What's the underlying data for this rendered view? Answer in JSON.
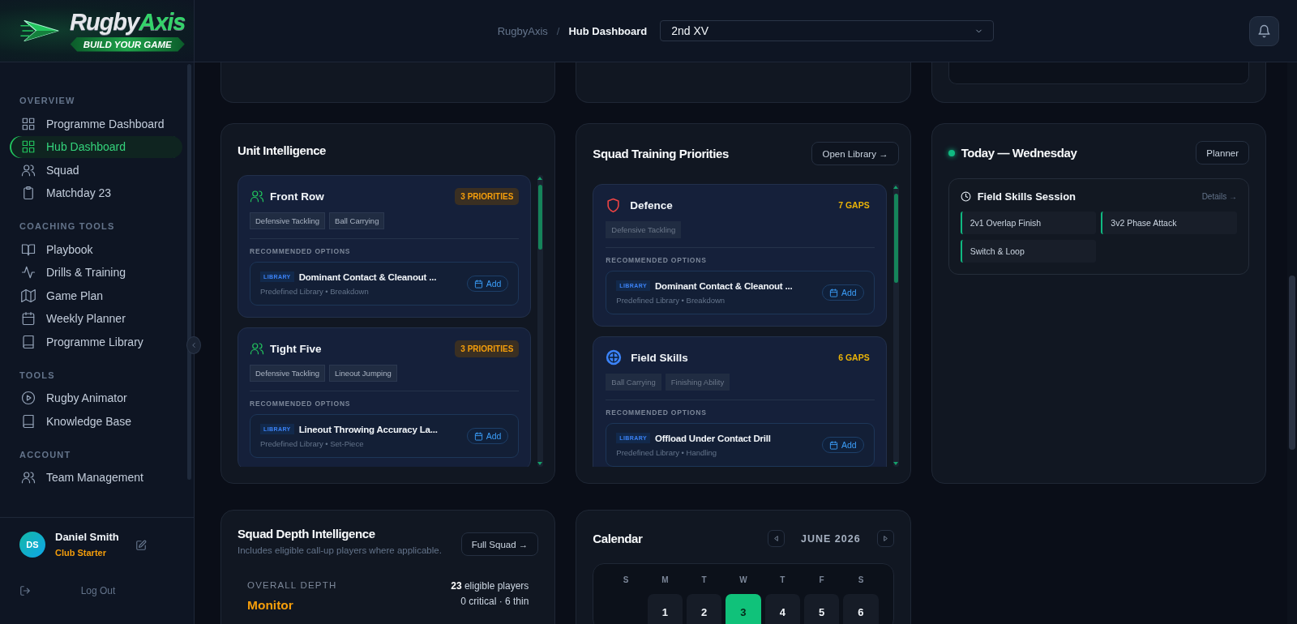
{
  "logo": {
    "name_a": "Rugby",
    "name_b": "Axis",
    "tagline": "BUILD YOUR GAME"
  },
  "header": {
    "breadcrumb": [
      "RugbyAxis",
      "Hub Dashboard"
    ],
    "breadcrumb_separator": "/",
    "team_select": {
      "value": "2nd XV"
    }
  },
  "sidebar": {
    "sections": [
      {
        "title": "OVERVIEW",
        "items": [
          {
            "label": "Programme Dashboard",
            "selected": false
          },
          {
            "label": "Hub Dashboard",
            "selected": true
          },
          {
            "label": "Squad",
            "selected": false
          },
          {
            "label": "Matchday 23",
            "selected": false
          }
        ]
      },
      {
        "title": "COACHING TOOLS",
        "items": [
          {
            "label": "Playbook",
            "selected": false
          },
          {
            "label": "Drills & Training",
            "selected": false
          },
          {
            "label": "Game Plan",
            "selected": false
          },
          {
            "label": "Weekly Planner",
            "selected": false
          },
          {
            "label": "Programme Library",
            "selected": false
          }
        ]
      },
      {
        "title": "TOOLS",
        "items": [
          {
            "label": "Rugby Animator",
            "selected": false
          },
          {
            "label": "Knowledge Base",
            "selected": false
          }
        ]
      },
      {
        "title": "ACCOUNT",
        "items": [
          {
            "label": "Team Management",
            "selected": false
          }
        ]
      }
    ],
    "user": {
      "initials": "DS",
      "name": "Daniel Smith",
      "plan": "Club Starter"
    },
    "logout": "Log Out"
  },
  "unit_intelligence": {
    "title": "Unit Intelligence",
    "units": [
      {
        "name": "Front Row",
        "badge": "3 PRIORITIES",
        "tags": [
          "Defensive Tackling",
          "Ball Carrying"
        ],
        "options_label": "RECOMMENDED OPTIONS",
        "options": [
          {
            "tag": "LIBRARY",
            "title": "Dominant Contact & Cleanout ...",
            "meta": "Predefined Library • Breakdown",
            "action": "Add"
          }
        ]
      },
      {
        "name": "Tight Five",
        "badge": "3 PRIORITIES",
        "tags": [
          "Defensive Tackling",
          "Lineout Jumping"
        ],
        "options_label": "RECOMMENDED OPTIONS",
        "options": [
          {
            "tag": "LIBRARY",
            "title": "Lineout Throwing Accuracy La...",
            "meta": "Predefined Library • Set-Piece",
            "action": "Add"
          }
        ]
      }
    ]
  },
  "training_priorities": {
    "title": "Squad Training Priorities",
    "button": "Open Library →",
    "areas": [
      {
        "name": "Defence",
        "badge": "7 GAPS",
        "tags": [
          "Defensive Tackling"
        ],
        "options_label": "RECOMMENDED OPTIONS",
        "options": [
          {
            "tag": "LIBRARY",
            "title": "Dominant Contact & Cleanout ...",
            "meta": "Predefined Library • Breakdown",
            "action": "Add"
          }
        ]
      },
      {
        "name": "Field Skills",
        "badge": "6 GAPS",
        "tags": [
          "Ball Carrying",
          "Finishing Ability"
        ],
        "options_label": "RECOMMENDED OPTIONS",
        "options": [
          {
            "tag": "LIBRARY",
            "title": "Offload Under Contact Drill",
            "meta": "Predefined Library • Handling",
            "action": "Add"
          }
        ]
      }
    ]
  },
  "today": {
    "title": "Today — Wednesday",
    "button": "Planner",
    "session": {
      "title": "Field Skills Session",
      "link": "Details →",
      "drills": [
        "2v1 Overlap Finish",
        "3v2 Phase Attack",
        "Switch & Loop"
      ]
    }
  },
  "squad_depth": {
    "title": "Squad Depth Intelligence",
    "subtitle": "Includes eligible call-up players where applicable.",
    "button": "Full Squad →",
    "depth_label": "OVERALL DEPTH",
    "depth_value": "Monitor",
    "players": "**23** eligible players",
    "summary": "0 critical · 6 thin"
  },
  "calendar": {
    "title": "Calendar",
    "month": "JUNE 2026",
    "weekdays": [
      "S",
      "M",
      "T",
      "W",
      "T",
      "F",
      "S"
    ],
    "days": [
      {
        "kind": "blank"
      },
      {
        "kind": "day",
        "label": "1",
        "selected": false
      },
      {
        "kind": "day",
        "label": "2",
        "selected": false
      },
      {
        "kind": "day",
        "label": "3",
        "selected": true
      },
      {
        "kind": "day",
        "label": "4",
        "selected": false
      },
      {
        "kind": "day",
        "label": "5",
        "selected": false
      },
      {
        "kind": "day",
        "label": "6",
        "selected": false
      }
    ]
  }
}
